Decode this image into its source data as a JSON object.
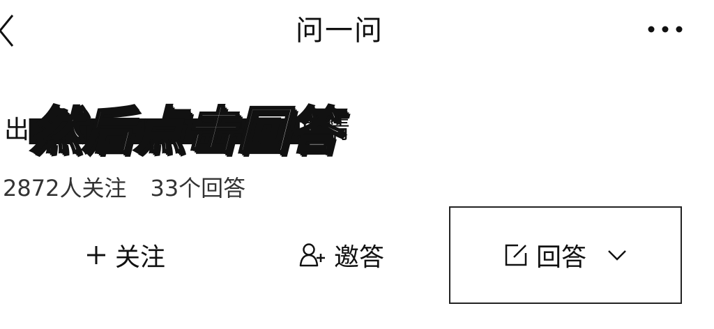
{
  "header": {
    "title": "问一问",
    "back_icon": "chevron-left-icon",
    "more_icon": "more-horizontal-icon"
  },
  "question": {
    "title": "出▇▇▇▇▇▇▇▇▇▇▇▇▇▇事情",
    "followers": "2872人关注",
    "answers_count": "33个回答"
  },
  "overlay": {
    "caption": "然后点击回答"
  },
  "actions": {
    "follow_label": "关注",
    "follow_icon": "plus-icon",
    "invite_label": "邀答",
    "invite_icon": "user-plus-icon",
    "answer_label": "回答",
    "answer_icon": "edit-icon",
    "answer_dropdown_icon": "chevron-down-icon"
  }
}
